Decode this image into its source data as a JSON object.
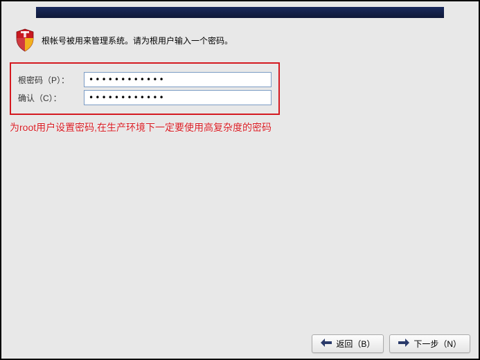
{
  "header": {
    "instruction": "根帐号被用来管理系统。请为根用户输入一个密码。"
  },
  "form": {
    "password_label": "根密码（P）：",
    "password_value": "••••••••••••",
    "confirm_label": "确认（C）：",
    "confirm_value": "••••••••••••"
  },
  "annotation": "为root用户设置密码,在生产环境下一定要使用高复杂度的密码",
  "footer": {
    "back_label": "返回（B）",
    "next_label": "下一步（N）"
  },
  "icons": {
    "shield": "shield-icon",
    "arrow_left": "arrow-left-icon",
    "arrow_right": "arrow-right-icon"
  }
}
